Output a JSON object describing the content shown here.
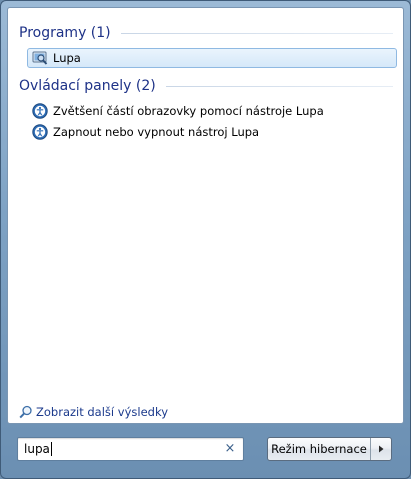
{
  "groups": [
    {
      "header": "Programy (1)",
      "items": [
        {
          "label": "Lupa",
          "icon": "magnifier-app-icon",
          "selected": true
        }
      ]
    },
    {
      "header": "Ovládací panely (2)",
      "items": [
        {
          "label": "Zvětšení částí obrazovky pomocí nástroje Lupa",
          "icon": "ease-of-access-icon"
        },
        {
          "label": "Zapnout nebo vypnout nástroj Lupa",
          "icon": "ease-of-access-icon"
        }
      ]
    }
  ],
  "more_results": {
    "label": "Zobrazit další výsledky",
    "icon": "search-icon"
  },
  "search": {
    "value": "lupa",
    "clear_icon": "clear-icon",
    "clear_glyph": "×"
  },
  "power": {
    "label": "Režim hibernace",
    "arrow_icon": "arrow-right-icon"
  },
  "colors": {
    "header": "#1e3287",
    "link": "#1b3a8c",
    "selection": "#d5e8f9"
  }
}
